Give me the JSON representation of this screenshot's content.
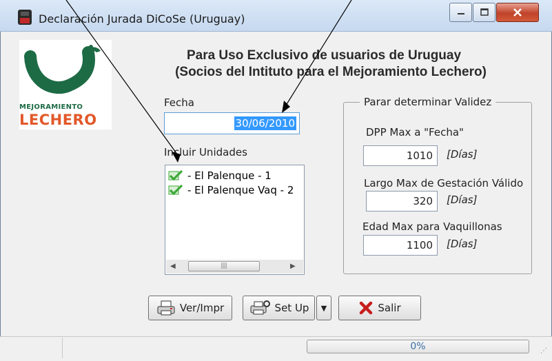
{
  "window": {
    "title": "Declaración Jurada DiCoSe (Uruguay)"
  },
  "logo": {
    "line1": "MEJORAMIENTO",
    "line2": "LECHERO"
  },
  "header": {
    "line1": "Para Uso Exclusivo de usuarios de Uruguay",
    "line2": "(Socios del Intituto para el Mejoramiento Lechero)"
  },
  "fecha": {
    "label": "Fecha",
    "value": "30/06/2010"
  },
  "unidades": {
    "label": "Incluir Unidades",
    "items": [
      {
        "label": "- El Palenque - 1",
        "checked": true
      },
      {
        "label": "- El Palenque Vaq - 2",
        "checked": true
      }
    ]
  },
  "validez": {
    "title": "Parar determinar Validez",
    "fields": [
      {
        "label": "DPP Max a \"Fecha\"",
        "value": "1010",
        "unit": "[Días]"
      },
      {
        "label": "Largo Max de Gestación Válido",
        "value": "320",
        "unit": "[Días]"
      },
      {
        "label": "Edad Max para Vaquillonas",
        "value": "1100",
        "unit": "[Días]"
      }
    ]
  },
  "buttons": {
    "ver": "Ver/Impr",
    "setup": "Set Up",
    "salir": "Salir"
  },
  "status": {
    "progress_text": "0%",
    "progress": 0
  },
  "colors": {
    "logo_green": "#1d6b45",
    "logo_red": "#e2582a",
    "check_green": "#3fa83a",
    "progress_text": "#3a6ea5"
  }
}
